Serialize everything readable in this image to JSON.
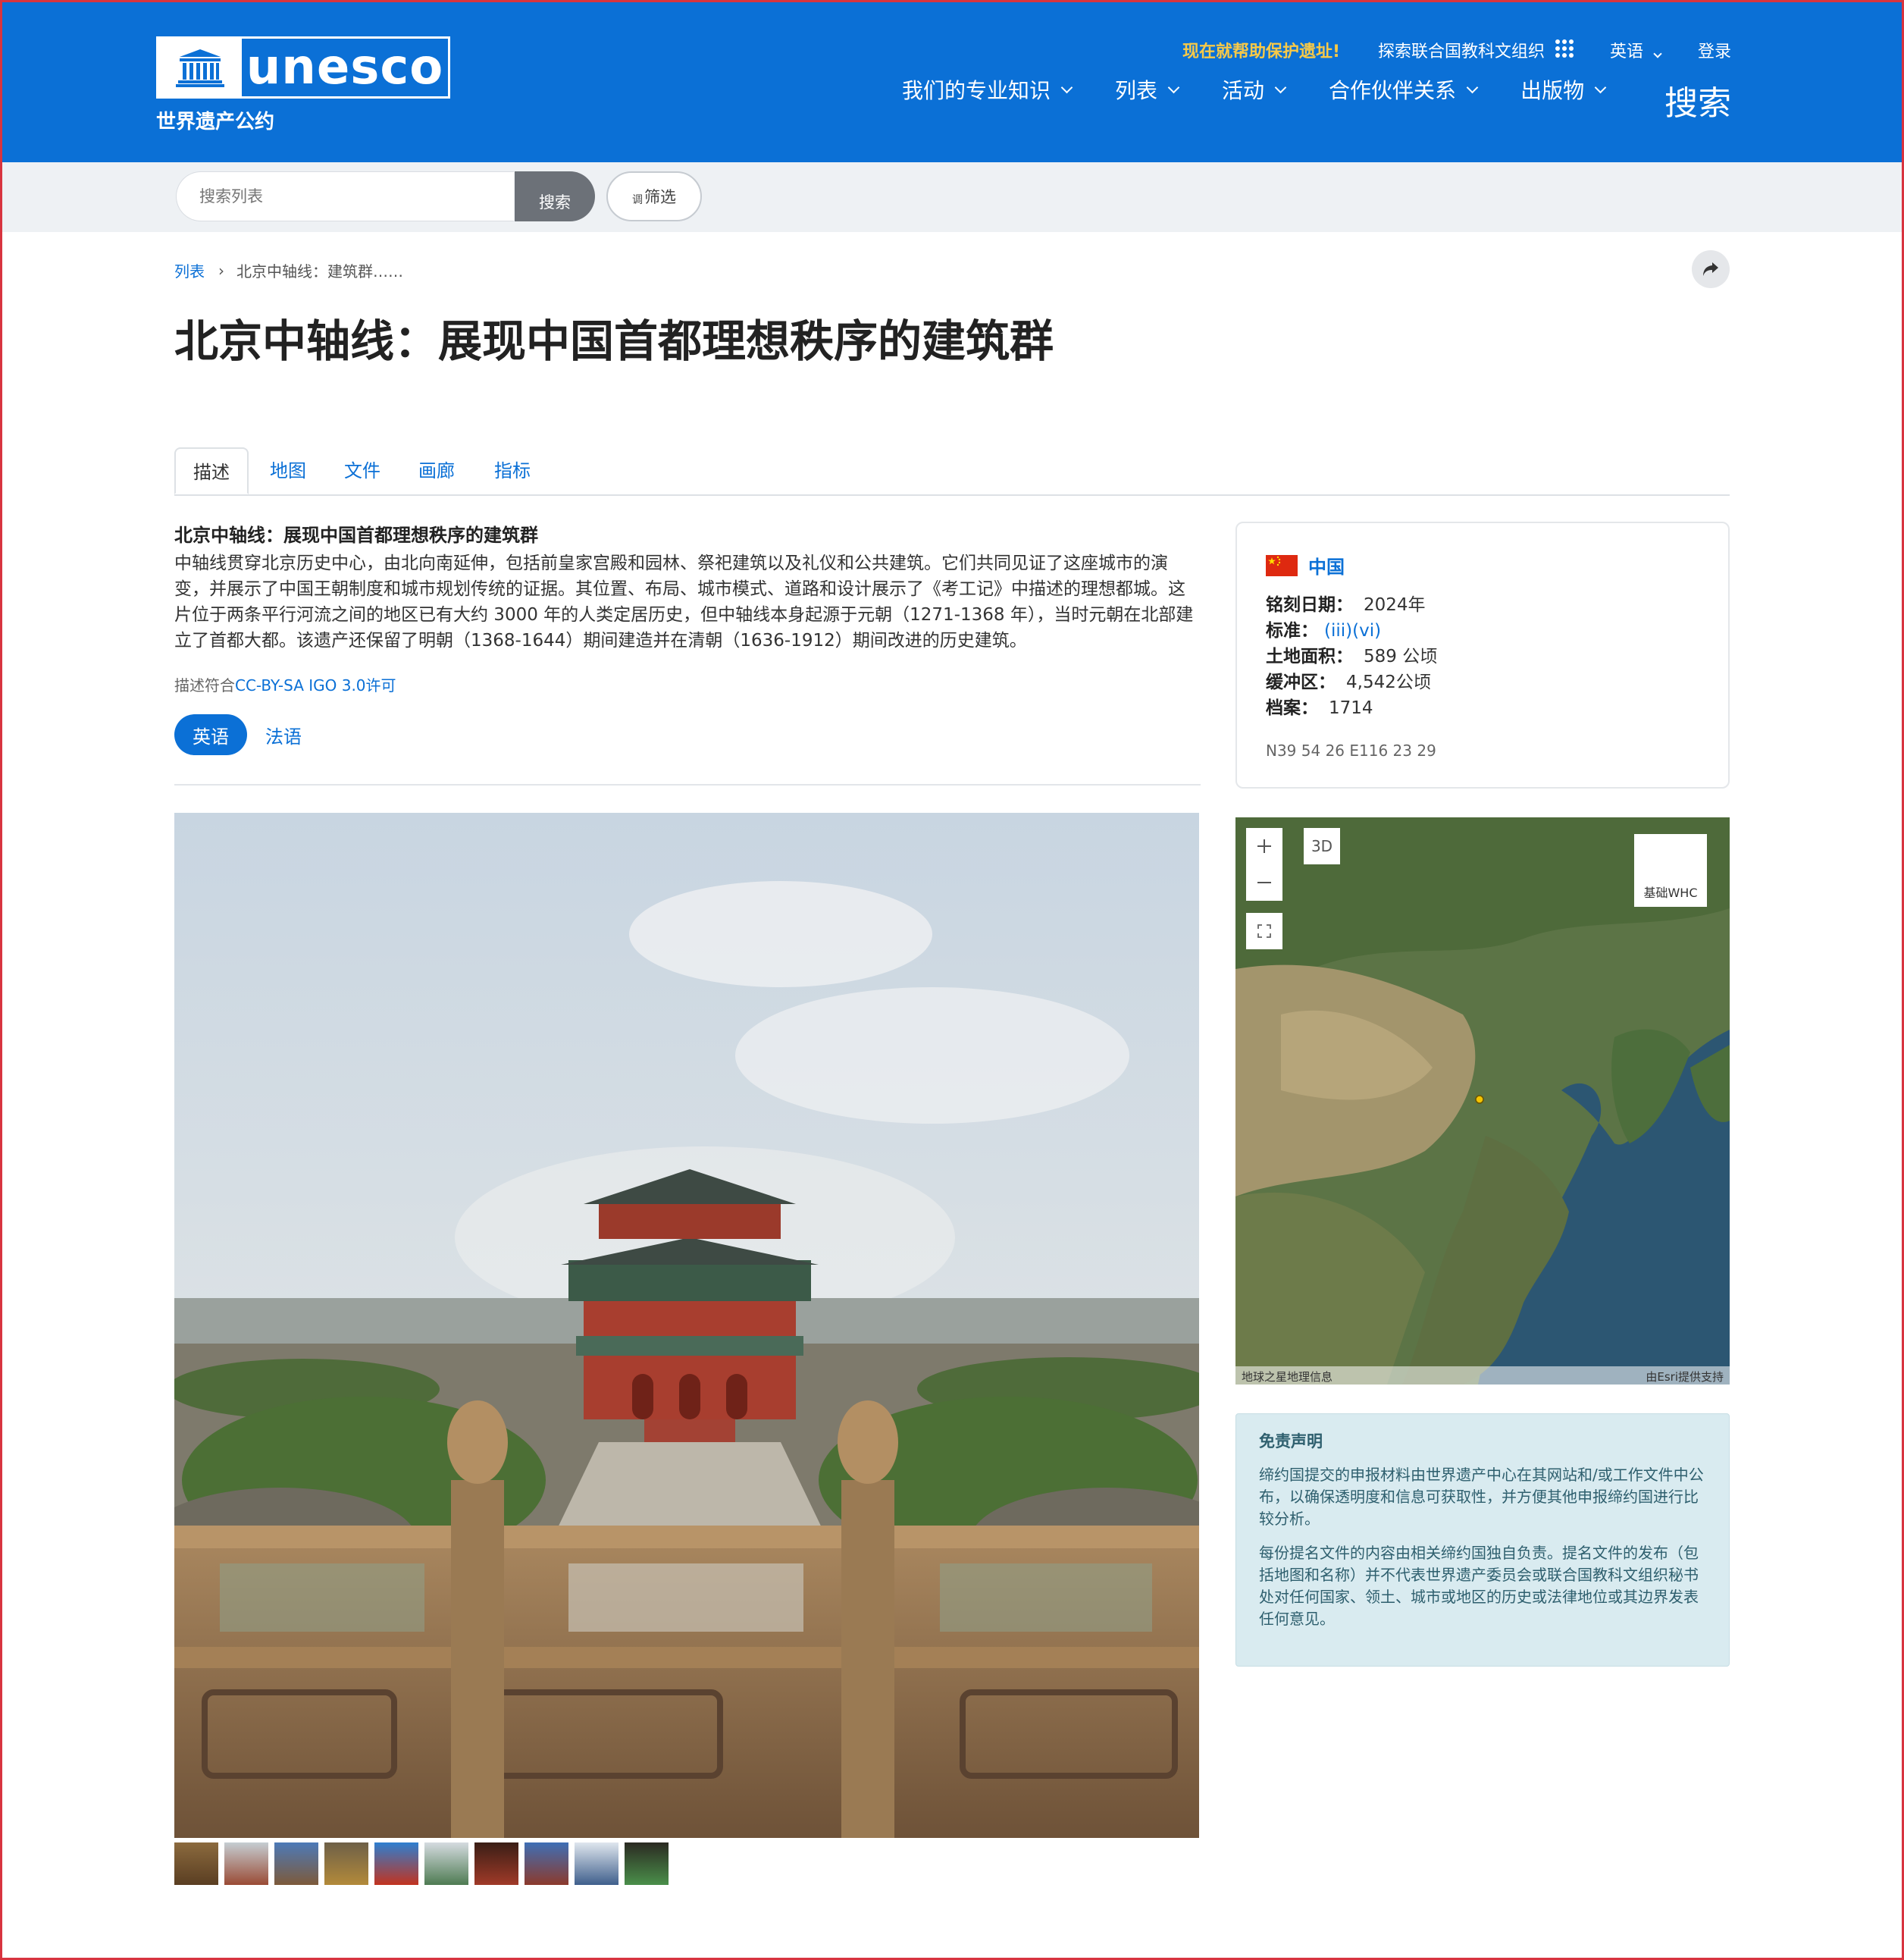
{
  "header": {
    "logo_text": "unesco",
    "subtitle": "世界遗产公约",
    "top_links": {
      "help": "现在就帮助保护遗址!",
      "explore": "探索联合国教科文组织",
      "language": "英语",
      "login": "登录"
    },
    "nav": [
      "我们的专业知识",
      "列表",
      "活动",
      "合作伙伴关系",
      "出版物"
    ],
    "search_label": "搜索",
    "brand_color": "#0b70d6",
    "accent_color": "#f7c948"
  },
  "search": {
    "placeholder": "搜索列表",
    "button": "搜索",
    "filter": "筛选",
    "filter_icon_text": "调"
  },
  "breadcrumb": {
    "home": "列表",
    "separator": "›",
    "current": "北京中轴线：建筑群……"
  },
  "title": "北京中轴线：展现中国首都理想秩序的建筑群",
  "tabs": [
    "描述",
    "地图",
    "文件",
    "画廊",
    "指标"
  ],
  "description": {
    "heading": "北京中轴线：展现中国首都理想秩序的建筑群",
    "body": "中轴线贯穿北京历史中心，由北向南延伸，包括前皇家宫殿和园林、祭祀建筑以及礼仪和公共建筑。它们共同见证了这座城市的演变，并展示了中国王朝制度和城市规划传统的证据。其位置、布局、城市模式、道路和设计展示了《考工记》中描述的理想都城。这片位于两条平行河流之间的地区已有大约 3000 年的人类定居历史，但中轴线本身起源于元朝（1271-1368 年），当时元朝在北部建立了首都大都。该遗产还保留了明朝（1368-1644）期间建造并在清朝（1636-1912）期间改进的历史建筑。",
    "license_prefix": "描述符合",
    "license_link": "CC-BY-SA IGO 3.0许可",
    "languages": [
      "英语",
      "法语"
    ]
  },
  "info": {
    "country": "中国",
    "flag_color": "#de2910",
    "rows": [
      {
        "label": "铭刻日期：",
        "value": "2024年"
      },
      {
        "label": "标准：",
        "value": "(iii)(vi)"
      },
      {
        "label": "土地面积：",
        "value": "589 公顷"
      },
      {
        "label": "缓冲区：",
        "value": "4,542公顷"
      },
      {
        "label": "档案：",
        "value": "1714"
      }
    ],
    "coordinates": "N39 54 26 E116 23 29"
  },
  "map": {
    "btn_3d": "3D",
    "basemap": "基础WHC",
    "attribution_left": "地球之星地理信息",
    "attribution_right": "由Esri提供支持"
  },
  "disclaimer": {
    "title": "免责声明",
    "paragraphs": [
      "缔约国提交的申报材料由世界遗产中心在其网站和/或工作文件中公布，以确保透明度和信息可获取性，并方便其他申报缔约国进行比较分析。",
      "每份提名文件的内容由相关缔约国独自负责。提名文件的发布（包括地图和名称）并不代表世界遗产委员会或联合国教科文组织秘书处对任何国家、领土、城市或地区的历史或法律地位或其边界发表任何意见。"
    ]
  }
}
